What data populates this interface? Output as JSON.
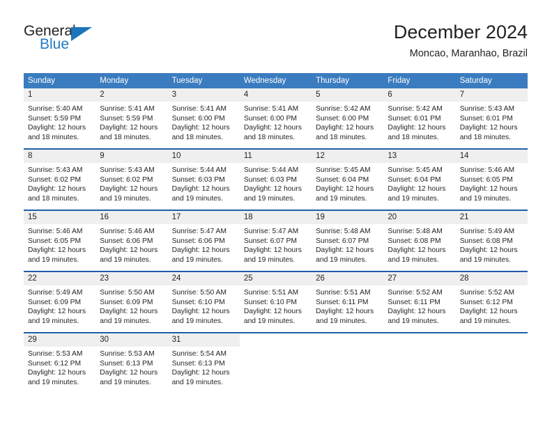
{
  "brand": {
    "name_part1": "General",
    "name_part2": "Blue",
    "accent_color": "#1b75bb"
  },
  "header": {
    "title": "December 2024",
    "subtitle": "Moncao, Maranhao, Brazil"
  },
  "calendar": {
    "header_color": "#3a7cbf",
    "row_separator_color": "#1f5ea8",
    "daynum_band_color": "#efefef",
    "weekdays": [
      "Sunday",
      "Monday",
      "Tuesday",
      "Wednesday",
      "Thursday",
      "Friday",
      "Saturday"
    ],
    "weeks": [
      [
        {
          "day": "1",
          "sunrise": "Sunrise: 5:40 AM",
          "sunset": "Sunset: 5:59 PM",
          "daylight1": "Daylight: 12 hours",
          "daylight2": "and 18 minutes."
        },
        {
          "day": "2",
          "sunrise": "Sunrise: 5:41 AM",
          "sunset": "Sunset: 5:59 PM",
          "daylight1": "Daylight: 12 hours",
          "daylight2": "and 18 minutes."
        },
        {
          "day": "3",
          "sunrise": "Sunrise: 5:41 AM",
          "sunset": "Sunset: 6:00 PM",
          "daylight1": "Daylight: 12 hours",
          "daylight2": "and 18 minutes."
        },
        {
          "day": "4",
          "sunrise": "Sunrise: 5:41 AM",
          "sunset": "Sunset: 6:00 PM",
          "daylight1": "Daylight: 12 hours",
          "daylight2": "and 18 minutes."
        },
        {
          "day": "5",
          "sunrise": "Sunrise: 5:42 AM",
          "sunset": "Sunset: 6:00 PM",
          "daylight1": "Daylight: 12 hours",
          "daylight2": "and 18 minutes."
        },
        {
          "day": "6",
          "sunrise": "Sunrise: 5:42 AM",
          "sunset": "Sunset: 6:01 PM",
          "daylight1": "Daylight: 12 hours",
          "daylight2": "and 18 minutes."
        },
        {
          "day": "7",
          "sunrise": "Sunrise: 5:43 AM",
          "sunset": "Sunset: 6:01 PM",
          "daylight1": "Daylight: 12 hours",
          "daylight2": "and 18 minutes."
        }
      ],
      [
        {
          "day": "8",
          "sunrise": "Sunrise: 5:43 AM",
          "sunset": "Sunset: 6:02 PM",
          "daylight1": "Daylight: 12 hours",
          "daylight2": "and 18 minutes."
        },
        {
          "day": "9",
          "sunrise": "Sunrise: 5:43 AM",
          "sunset": "Sunset: 6:02 PM",
          "daylight1": "Daylight: 12 hours",
          "daylight2": "and 19 minutes."
        },
        {
          "day": "10",
          "sunrise": "Sunrise: 5:44 AM",
          "sunset": "Sunset: 6:03 PM",
          "daylight1": "Daylight: 12 hours",
          "daylight2": "and 19 minutes."
        },
        {
          "day": "11",
          "sunrise": "Sunrise: 5:44 AM",
          "sunset": "Sunset: 6:03 PM",
          "daylight1": "Daylight: 12 hours",
          "daylight2": "and 19 minutes."
        },
        {
          "day": "12",
          "sunrise": "Sunrise: 5:45 AM",
          "sunset": "Sunset: 6:04 PM",
          "daylight1": "Daylight: 12 hours",
          "daylight2": "and 19 minutes."
        },
        {
          "day": "13",
          "sunrise": "Sunrise: 5:45 AM",
          "sunset": "Sunset: 6:04 PM",
          "daylight1": "Daylight: 12 hours",
          "daylight2": "and 19 minutes."
        },
        {
          "day": "14",
          "sunrise": "Sunrise: 5:46 AM",
          "sunset": "Sunset: 6:05 PM",
          "daylight1": "Daylight: 12 hours",
          "daylight2": "and 19 minutes."
        }
      ],
      [
        {
          "day": "15",
          "sunrise": "Sunrise: 5:46 AM",
          "sunset": "Sunset: 6:05 PM",
          "daylight1": "Daylight: 12 hours",
          "daylight2": "and 19 minutes."
        },
        {
          "day": "16",
          "sunrise": "Sunrise: 5:46 AM",
          "sunset": "Sunset: 6:06 PM",
          "daylight1": "Daylight: 12 hours",
          "daylight2": "and 19 minutes."
        },
        {
          "day": "17",
          "sunrise": "Sunrise: 5:47 AM",
          "sunset": "Sunset: 6:06 PM",
          "daylight1": "Daylight: 12 hours",
          "daylight2": "and 19 minutes."
        },
        {
          "day": "18",
          "sunrise": "Sunrise: 5:47 AM",
          "sunset": "Sunset: 6:07 PM",
          "daylight1": "Daylight: 12 hours",
          "daylight2": "and 19 minutes."
        },
        {
          "day": "19",
          "sunrise": "Sunrise: 5:48 AM",
          "sunset": "Sunset: 6:07 PM",
          "daylight1": "Daylight: 12 hours",
          "daylight2": "and 19 minutes."
        },
        {
          "day": "20",
          "sunrise": "Sunrise: 5:48 AM",
          "sunset": "Sunset: 6:08 PM",
          "daylight1": "Daylight: 12 hours",
          "daylight2": "and 19 minutes."
        },
        {
          "day": "21",
          "sunrise": "Sunrise: 5:49 AM",
          "sunset": "Sunset: 6:08 PM",
          "daylight1": "Daylight: 12 hours",
          "daylight2": "and 19 minutes."
        }
      ],
      [
        {
          "day": "22",
          "sunrise": "Sunrise: 5:49 AM",
          "sunset": "Sunset: 6:09 PM",
          "daylight1": "Daylight: 12 hours",
          "daylight2": "and 19 minutes."
        },
        {
          "day": "23",
          "sunrise": "Sunrise: 5:50 AM",
          "sunset": "Sunset: 6:09 PM",
          "daylight1": "Daylight: 12 hours",
          "daylight2": "and 19 minutes."
        },
        {
          "day": "24",
          "sunrise": "Sunrise: 5:50 AM",
          "sunset": "Sunset: 6:10 PM",
          "daylight1": "Daylight: 12 hours",
          "daylight2": "and 19 minutes."
        },
        {
          "day": "25",
          "sunrise": "Sunrise: 5:51 AM",
          "sunset": "Sunset: 6:10 PM",
          "daylight1": "Daylight: 12 hours",
          "daylight2": "and 19 minutes."
        },
        {
          "day": "26",
          "sunrise": "Sunrise: 5:51 AM",
          "sunset": "Sunset: 6:11 PM",
          "daylight1": "Daylight: 12 hours",
          "daylight2": "and 19 minutes."
        },
        {
          "day": "27",
          "sunrise": "Sunrise: 5:52 AM",
          "sunset": "Sunset: 6:11 PM",
          "daylight1": "Daylight: 12 hours",
          "daylight2": "and 19 minutes."
        },
        {
          "day": "28",
          "sunrise": "Sunrise: 5:52 AM",
          "sunset": "Sunset: 6:12 PM",
          "daylight1": "Daylight: 12 hours",
          "daylight2": "and 19 minutes."
        }
      ],
      [
        {
          "day": "29",
          "sunrise": "Sunrise: 5:53 AM",
          "sunset": "Sunset: 6:12 PM",
          "daylight1": "Daylight: 12 hours",
          "daylight2": "and 19 minutes."
        },
        {
          "day": "30",
          "sunrise": "Sunrise: 5:53 AM",
          "sunset": "Sunset: 6:13 PM",
          "daylight1": "Daylight: 12 hours",
          "daylight2": "and 19 minutes."
        },
        {
          "day": "31",
          "sunrise": "Sunrise: 5:54 AM",
          "sunset": "Sunset: 6:13 PM",
          "daylight1": "Daylight: 12 hours",
          "daylight2": "and 19 minutes."
        },
        {
          "day": "",
          "sunrise": "",
          "sunset": "",
          "daylight1": "",
          "daylight2": ""
        },
        {
          "day": "",
          "sunrise": "",
          "sunset": "",
          "daylight1": "",
          "daylight2": ""
        },
        {
          "day": "",
          "sunrise": "",
          "sunset": "",
          "daylight1": "",
          "daylight2": ""
        },
        {
          "day": "",
          "sunrise": "",
          "sunset": "",
          "daylight1": "",
          "daylight2": ""
        }
      ]
    ]
  }
}
